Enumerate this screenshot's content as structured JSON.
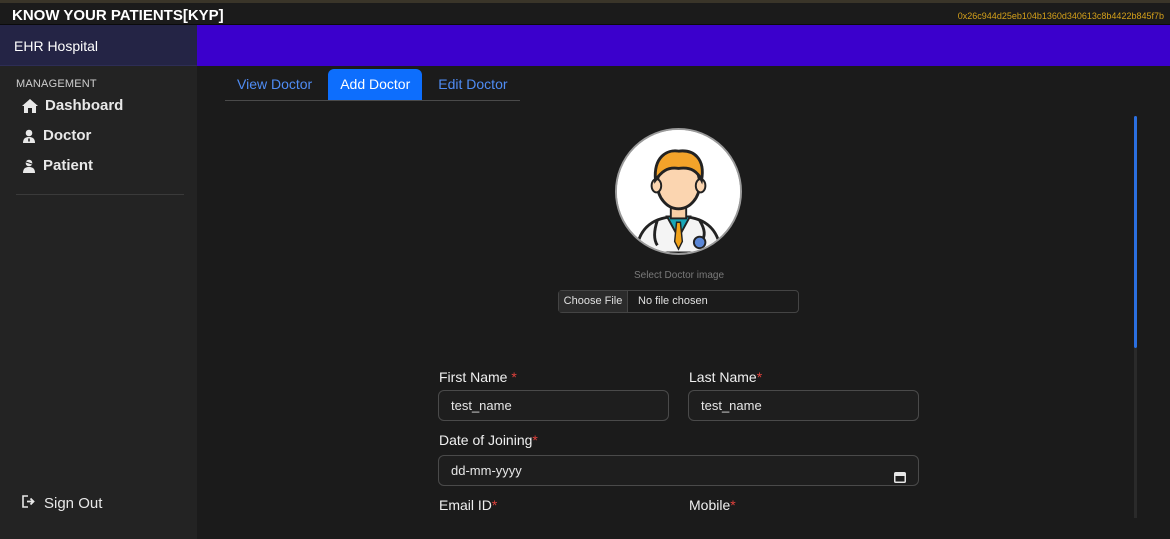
{
  "app": {
    "title": "KNOW YOUR PATIENTS[KYP]",
    "account": "0x26c944d25eb104b1360d340613c8b4422b845f7b",
    "brand": "EHR Hospital"
  },
  "sidebar": {
    "section": "MANAGEMENT",
    "items": [
      {
        "label": "Dashboard",
        "icon": "home-icon"
      },
      {
        "label": "Doctor",
        "icon": "user-md-icon"
      },
      {
        "label": "Patient",
        "icon": "user-injured-icon"
      }
    ],
    "signout": "Sign Out"
  },
  "tabs": [
    {
      "label": "View Doctor",
      "active": false
    },
    {
      "label": "Add Doctor",
      "active": true
    },
    {
      "label": "Edit Doctor",
      "active": false
    }
  ],
  "form": {
    "image_caption": "Select Doctor image",
    "file_button": "Choose File",
    "file_status": "No file chosen",
    "first_name_label": "First Name",
    "first_name_value": "test_name",
    "last_name_label": "Last Name",
    "last_name_value": "test_name",
    "doj_label": "Date of Joining",
    "doj_value": "dd-mm-yyyy",
    "email_label": "Email ID",
    "mobile_label": "Mobile",
    "required_mark": "*"
  },
  "colors": {
    "accent": "#0d6efd",
    "header": "#3b00cc",
    "account": "#d4a01a",
    "required": "#e0413c"
  }
}
